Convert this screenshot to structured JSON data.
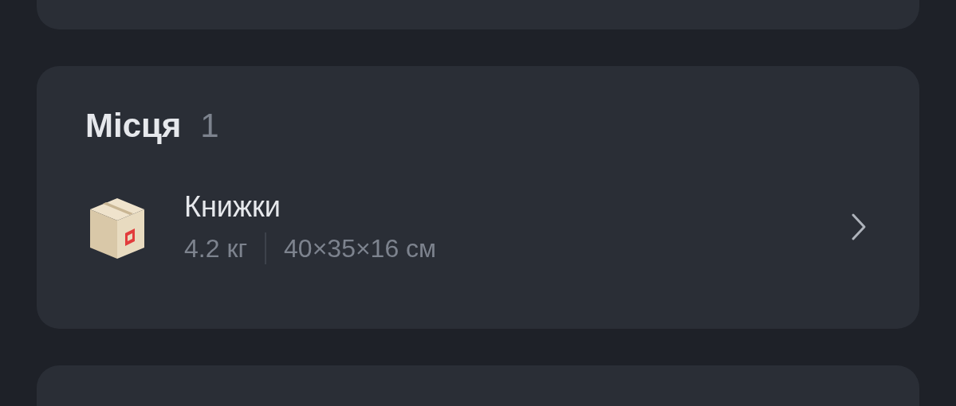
{
  "places": {
    "title": "Місця",
    "count": "1",
    "items": [
      {
        "name": "Книжки",
        "weight": "4.2 кг",
        "dimensions": "40×35×16 см"
      }
    ]
  }
}
